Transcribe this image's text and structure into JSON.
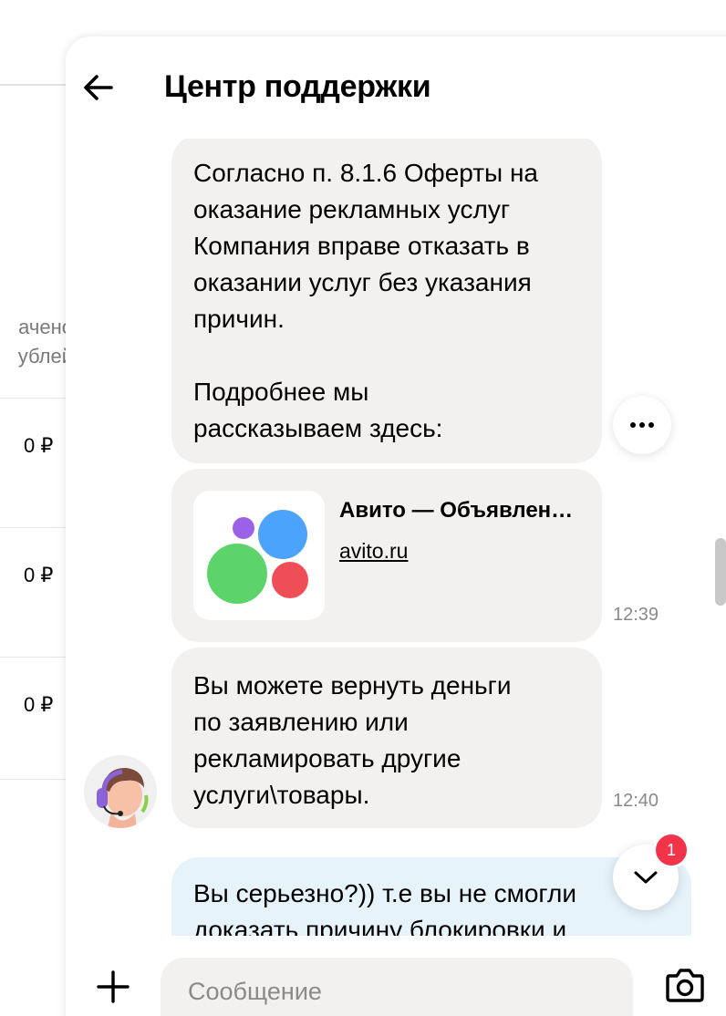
{
  "background": {
    "column_header_line1": "ачено",
    "column_header_line2": "ублей",
    "amounts": [
      "0 ₽",
      "0 ₽",
      "0 ₽"
    ]
  },
  "header": {
    "title": "Центр поддержки"
  },
  "messages": [
    {
      "type": "text",
      "text": "Согласно п. 8.1.6 Оферты на\nоказание рекламных услуг\nКомпания вправе отказать в\nоказании услуг без указания\nпричин.\n\nПодробнее мы\nрассказываем здесь:"
    },
    {
      "type": "link",
      "title": "Авито — Объявления на сайте Авито",
      "url": "avito.ru",
      "time": "12:39"
    },
    {
      "type": "text",
      "text": "Вы можете вернуть деньги\nпо заявлению или\nрекламировать другие\nуслуги\\товары.",
      "time": "12:40"
    },
    {
      "type": "text",
      "own": true,
      "text": "Вы серьезно?)) т.е вы не смогли\nдоказать причину блокировки и"
    }
  ],
  "scroll_button": {
    "badge": "1"
  },
  "composer": {
    "placeholder": "Сообщение"
  },
  "colors": {
    "incoming_bubble": "#f2f1f0",
    "outgoing_bubble": "#e6f3fa",
    "badge": "#f2344a",
    "logo_blue": "#4ba3fb",
    "logo_green": "#5cd46a",
    "logo_red": "#f04e57",
    "logo_purple": "#9b61e7"
  },
  "icons": [
    "back-arrow-icon",
    "more-dots-icon",
    "avito-logo-icon",
    "support-avatar-icon",
    "chevron-down-icon",
    "plus-icon",
    "camera-icon"
  ]
}
